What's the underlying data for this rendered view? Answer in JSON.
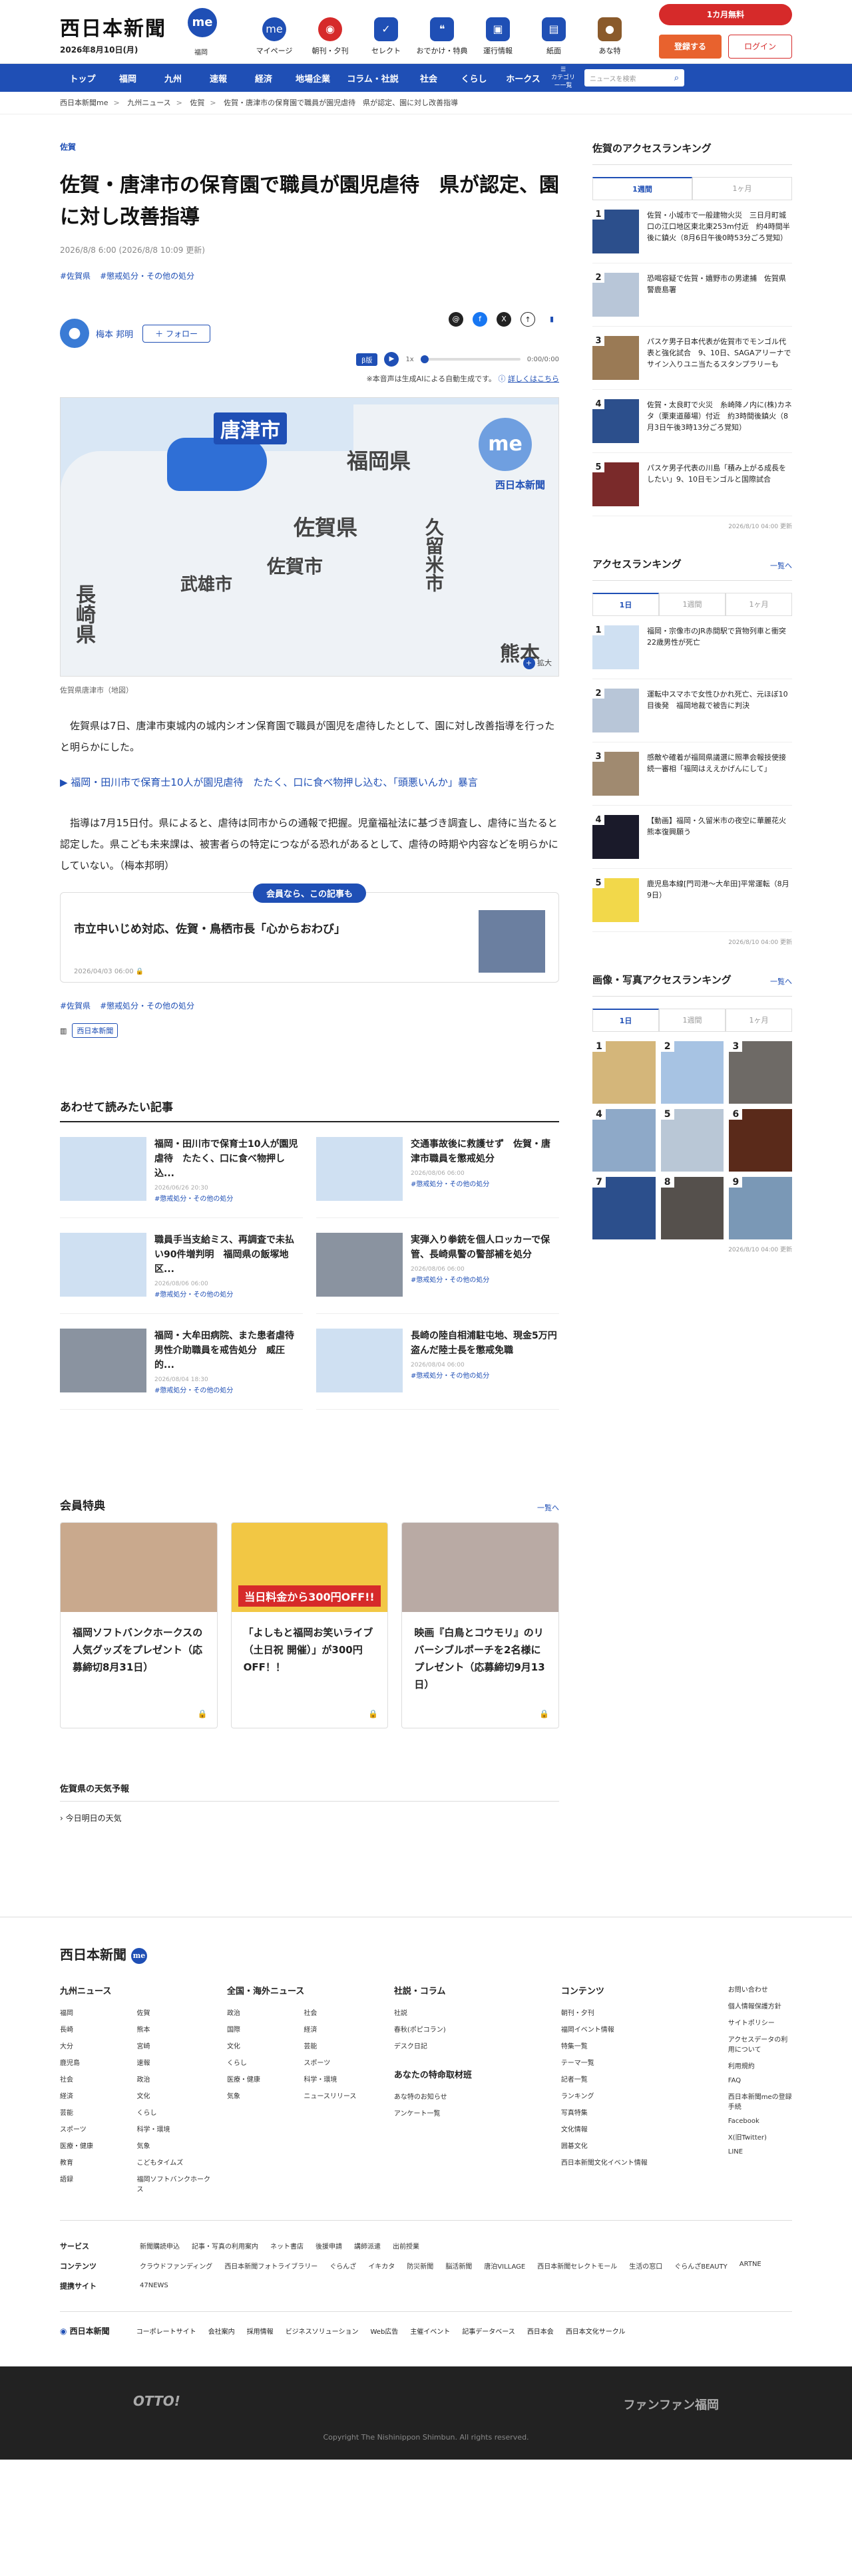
{
  "header": {
    "logo": "西日本新聞",
    "me": "me",
    "me_sub": "福岡",
    "date": "2026年8月10日(月)",
    "nav": [
      {
        "label": "マイページ",
        "icon": "me-icon"
      },
      {
        "label": "朝刊・夕刊",
        "icon": "newspaper-icon"
      },
      {
        "label": "セレクト",
        "icon": "select-icon"
      },
      {
        "label": "おでかけ・特典",
        "icon": "footprint-icon"
      },
      {
        "label": "運行情報",
        "icon": "train-icon"
      },
      {
        "label": "紙面",
        "icon": "paper-icon"
      },
      {
        "label": "あな特",
        "icon": "dog-icon"
      }
    ],
    "trial": "1カ月無料",
    "register": "登録する",
    "login": "ログイン"
  },
  "gnav": {
    "items": [
      "トップ",
      "福岡",
      "九州",
      "速報",
      "経済",
      "地場企業",
      "コラム・社説",
      "社会",
      "くらし",
      "ホークス"
    ],
    "category": "カテゴリー一覧",
    "search_placeholder": "ニュースを検索"
  },
  "breadcrumb": [
    "西日本新聞me",
    "九州ニュース",
    "佐賀",
    "佐賀・唐津市の保育園で職員が園児虐待　県が認定、園に対し改善指導"
  ],
  "article": {
    "category": "佐賀",
    "title": "佐賀・唐津市の保育園で職員が園児虐待　県が認定、園に対し改善指導",
    "date": "2026/8/8 6:00 (2026/8/8 10:09 更新)",
    "tags": [
      "#佐賀県",
      "#懲戒処分・その他の処分"
    ],
    "author": "梅本 邦明",
    "follow": "＋ フォロー",
    "player_badge": "β版",
    "player_speed": "1x",
    "player_time": "0:00/0:00",
    "ai_note": "※本音声は生成AIによる自動生成です。",
    "ai_link": "詳しくはこちら",
    "map_labels": {
      "karatsu": "唐津市",
      "fukuoka": "福岡県",
      "saga_pref": "佐賀県",
      "saga_city": "佐賀市",
      "takeo": "武雄市",
      "kurume": "久留米市",
      "nagasaki": "長崎県",
      "kumamoto": "熊本",
      "brand": "西日本新聞",
      "zoom": "拡大"
    },
    "caption": "佐賀県唐津市（地図）",
    "p1": "佐賀県は7日、唐津市東城内の城内シオン保育園で職員が園児を虐待したとして、園に対し改善指導を行ったと明らかにした。",
    "related_link": "▶ 福岡・田川市で保育士10人が園児虐待　たたく、口に食べ物押し込む、「頭悪いんか」暴言",
    "p2": "指導は7月15日付。県によると、虐待は同市からの通報で把握。児童福祉法に基づき調査し、虐待に当たると認定した。県こども未来課は、被害者らの特定につながる恐れがあるとして、虐待の時期や内容などを明らかにしていない。（梅本邦明）",
    "member_badge": "会員なら、この記事も",
    "member_title": "市立中いじめ対応、佐賀・鳥栖市長「心からおわび」",
    "member_date": "2026/04/03 06:00",
    "tags2": [
      "#佐賀県",
      "#懲戒処分・その他の処分"
    ],
    "publisher_label": "西日本新聞"
  },
  "related": {
    "heading": "あわせて読みたい記事",
    "items": [
      {
        "title": "福岡・田川市で保育士10人が園児虐待　たたく、口に食べ物押し込...",
        "date": "2026/06/26 20:30",
        "tag": "#懲戒処分・その他の処分"
      },
      {
        "title": "交通事故後に救護せず　佐賀・唐津市職員を懲戒処分",
        "date": "2026/08/06 06:00",
        "tag": "#懲戒処分・その他の処分"
      },
      {
        "title": "職員手当支給ミス、再調査で未払い90件増判明　福岡県の飯塚地区...",
        "date": "2026/08/06 06:00",
        "tag": "#懲戒処分・その他の処分"
      },
      {
        "title": "実弾入り拳銃を個人ロッカーで保管、長崎県警の警部補を処分",
        "date": "2026/08/06 06:00",
        "tag": "#懲戒処分・その他の処分"
      },
      {
        "title": "福岡・大牟田病院、また患者虐待　男性介助職員を戒告処分　威圧的...",
        "date": "2026/08/04 18:30",
        "tag": "#懲戒処分・その他の処分"
      },
      {
        "title": "長崎の陸自相浦駐屯地、現金5万円盗んだ陸士長を懲戒免職",
        "date": "2026/08/04 06:00",
        "tag": "#懲戒処分・その他の処分"
      }
    ]
  },
  "perks": {
    "heading": "会員特典",
    "more": "一覧へ",
    "items": [
      {
        "title": "福岡ソフトバンクホークスの人気グッズをプレゼント（応募締切8月31日）"
      },
      {
        "title": "「よしもと福岡お笑いライブ（土日祝 開催）」が300円OFF！！",
        "banner": "当日料金から300円OFF!!"
      },
      {
        "title": "映画『白鳥とコウモリ』のリバーシブルポーチを2名様にプレゼント（応募締切9月13日）"
      }
    ]
  },
  "weather": {
    "heading": "佐賀県の天気予報",
    "sub": "今日明日の天気"
  },
  "sidebar": {
    "access_heading": "佐賀のアクセスランキング",
    "tabs": [
      "1週間",
      "1ヶ月"
    ],
    "saga_rank": [
      "佐賀・小城市で一般建物火災　三日月町城口の江口地区東北東253m付近　約4時間半後に鎮火（8月6日午後0時53分ごろ覚知）",
      "恐喝容疑で佐賀・嬉野市の男逮捕　佐賀県警鹿島署",
      "パスケ男子日本代表が佐賀市でモンゴル代表と強化試合　9、10日、SAGAアリーナで　サイン入りユニ当たるスタンプラリーも",
      "佐賀・太良町で火災　糸崎降ノ内に(株)カネタ（栗東道藤場）付近　約3時間後鎮火（8月3日午後3時13分ごろ覚知）",
      "パスケ男子代表の川島「積み上がる成長をしたい」9、10日モンゴルと国際試合"
    ],
    "saga_updated": "2026/8/10 04:00 更新",
    "rank_heading": "アクセスランキング",
    "rank_more": "一覧へ",
    "rank_tabs": [
      "1日",
      "1週間",
      "1ヶ月"
    ],
    "rank": [
      "福岡・宗像市のJR赤間駅で貨物列車と衝突　22歳男性が死亡",
      "運転中スマホで女性ひかれ死亡、元ほぼ10目後発　福岡地裁で被告に判決",
      "感敵や確着が福岡県議選に照準会報技使接続一審相「福岡はええかげんにして」",
      "【動画】福岡・久留米市の夜空に華麗花火　熊本復興願う",
      "鹿児島本線[門司港〜大牟田]平常運転（8月9日）"
    ],
    "rank_updated": "2026/8/10 04:00 更新",
    "photo_heading": "画像・写真アクセスランキング",
    "photo_more": "一覧へ",
    "photo_tabs": [
      "1日",
      "1週間",
      "1ヶ月"
    ],
    "photo_nums": [
      "1",
      "2",
      "3",
      "4",
      "5",
      "6",
      "7",
      "8",
      "9"
    ],
    "photo_updated": "2026/8/10 04:00 更新"
  },
  "footer": {
    "logo": "西日本新聞",
    "cols": [
      {
        "h": "九州ニュース",
        "items": [
          "福岡",
          "佐賀",
          "長崎",
          "熊本",
          "大分",
          "宮崎",
          "鹿児島",
          "速報",
          "社会",
          "政治",
          "経済",
          "文化",
          "芸能",
          "くらし",
          "スポーツ",
          "科学・環境",
          "医療・健康",
          "気象",
          "教育",
          "こどもタイムズ",
          "語録",
          "福岡ソフトバンクホークス"
        ]
      },
      {
        "h": "全国・海外ニュース",
        "items": [
          "政治",
          "社会",
          "国際",
          "経済",
          "文化",
          "芸能",
          "くらし",
          "スポーツ",
          "医療・健康",
          "科学・環境",
          "気象",
          "ニュースリリース"
        ]
      },
      {
        "h": "社説・コラム",
        "items": [
          "社説",
          "春秋(ポピコラン)",
          "デスク日記"
        ],
        "h2": "あなたの特命取材班",
        "items2": [
          "あな特のお知らせ",
          "アンケート一覧"
        ]
      },
      {
        "h": "コンテンツ",
        "items": [
          "朝刊・夕刊",
          "福岡イベント情報",
          "特集一覧",
          "テーマ一覧",
          "記者一覧",
          "ランキング",
          "写真特集",
          "文化情報",
          "囲碁文化",
          "西日本新聞文化イベント情報"
        ]
      }
    ],
    "last": [
      "お問い合わせ",
      "個人情報保護方針",
      "サイトポリシー",
      "アクセスデータの利用について",
      "利用規約",
      "FAQ",
      "西日本新聞meの登録手続",
      "Facebook",
      "X(旧Twitter)",
      "LINE"
    ],
    "rows": [
      {
        "k": "サービス",
        "v": [
          "新聞購読申込",
          "記事・写真の利用案内",
          "ネット書店",
          "後援申請",
          "講師派遣",
          "出前授業"
        ]
      },
      {
        "k": "コンテンツ",
        "v": [
          "クラウドファンディング",
          "西日本新聞フォトライブラリー",
          "ぐらんざ",
          "イキカタ",
          "防災新聞",
          "脳活新聞",
          "唐泊VILLAGE",
          "西日本新聞セレクトモール",
          "生活の窓口",
          "ぐらんざBEAUTY",
          "ARTNE"
        ]
      },
      {
        "k": "提携サイト",
        "v": [
          "47NEWS"
        ]
      }
    ],
    "corp_label": "西日本新聞",
    "corp_links": [
      "コーポレートサイト",
      "会社案内",
      "採用情報",
      "ビジネスソリューション",
      "Web広告",
      "主催イベント",
      "記事データベース",
      "西日本会",
      "西日本文化サークル"
    ],
    "otto": "OTTO!",
    "fanfan": "ファンファン福岡",
    "copyright": "Copyright The Nishinippon Shimbun. All rights reserved."
  }
}
